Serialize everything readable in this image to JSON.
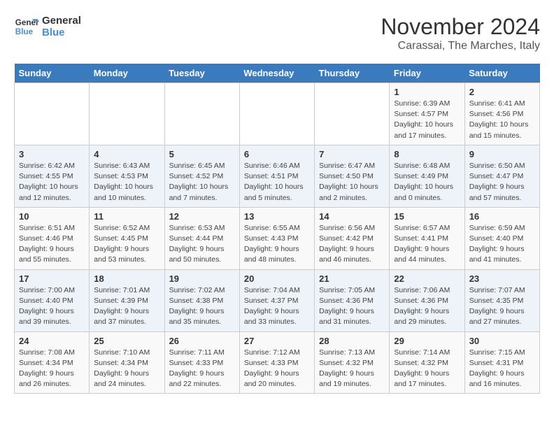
{
  "logo": {
    "line1": "General",
    "line2": "Blue"
  },
  "title": "November 2024",
  "location": "Carassai, The Marches, Italy",
  "days_of_week": [
    "Sunday",
    "Monday",
    "Tuesday",
    "Wednesday",
    "Thursday",
    "Friday",
    "Saturday"
  ],
  "weeks": [
    [
      {
        "day": "",
        "info": ""
      },
      {
        "day": "",
        "info": ""
      },
      {
        "day": "",
        "info": ""
      },
      {
        "day": "",
        "info": ""
      },
      {
        "day": "",
        "info": ""
      },
      {
        "day": "1",
        "info": "Sunrise: 6:39 AM\nSunset: 4:57 PM\nDaylight: 10 hours and 17 minutes."
      },
      {
        "day": "2",
        "info": "Sunrise: 6:41 AM\nSunset: 4:56 PM\nDaylight: 10 hours and 15 minutes."
      }
    ],
    [
      {
        "day": "3",
        "info": "Sunrise: 6:42 AM\nSunset: 4:55 PM\nDaylight: 10 hours and 12 minutes."
      },
      {
        "day": "4",
        "info": "Sunrise: 6:43 AM\nSunset: 4:53 PM\nDaylight: 10 hours and 10 minutes."
      },
      {
        "day": "5",
        "info": "Sunrise: 6:45 AM\nSunset: 4:52 PM\nDaylight: 10 hours and 7 minutes."
      },
      {
        "day": "6",
        "info": "Sunrise: 6:46 AM\nSunset: 4:51 PM\nDaylight: 10 hours and 5 minutes."
      },
      {
        "day": "7",
        "info": "Sunrise: 6:47 AM\nSunset: 4:50 PM\nDaylight: 10 hours and 2 minutes."
      },
      {
        "day": "8",
        "info": "Sunrise: 6:48 AM\nSunset: 4:49 PM\nDaylight: 10 hours and 0 minutes."
      },
      {
        "day": "9",
        "info": "Sunrise: 6:50 AM\nSunset: 4:47 PM\nDaylight: 9 hours and 57 minutes."
      }
    ],
    [
      {
        "day": "10",
        "info": "Sunrise: 6:51 AM\nSunset: 4:46 PM\nDaylight: 9 hours and 55 minutes."
      },
      {
        "day": "11",
        "info": "Sunrise: 6:52 AM\nSunset: 4:45 PM\nDaylight: 9 hours and 53 minutes."
      },
      {
        "day": "12",
        "info": "Sunrise: 6:53 AM\nSunset: 4:44 PM\nDaylight: 9 hours and 50 minutes."
      },
      {
        "day": "13",
        "info": "Sunrise: 6:55 AM\nSunset: 4:43 PM\nDaylight: 9 hours and 48 minutes."
      },
      {
        "day": "14",
        "info": "Sunrise: 6:56 AM\nSunset: 4:42 PM\nDaylight: 9 hours and 46 minutes."
      },
      {
        "day": "15",
        "info": "Sunrise: 6:57 AM\nSunset: 4:41 PM\nDaylight: 9 hours and 44 minutes."
      },
      {
        "day": "16",
        "info": "Sunrise: 6:59 AM\nSunset: 4:40 PM\nDaylight: 9 hours and 41 minutes."
      }
    ],
    [
      {
        "day": "17",
        "info": "Sunrise: 7:00 AM\nSunset: 4:40 PM\nDaylight: 9 hours and 39 minutes."
      },
      {
        "day": "18",
        "info": "Sunrise: 7:01 AM\nSunset: 4:39 PM\nDaylight: 9 hours and 37 minutes."
      },
      {
        "day": "19",
        "info": "Sunrise: 7:02 AM\nSunset: 4:38 PM\nDaylight: 9 hours and 35 minutes."
      },
      {
        "day": "20",
        "info": "Sunrise: 7:04 AM\nSunset: 4:37 PM\nDaylight: 9 hours and 33 minutes."
      },
      {
        "day": "21",
        "info": "Sunrise: 7:05 AM\nSunset: 4:36 PM\nDaylight: 9 hours and 31 minutes."
      },
      {
        "day": "22",
        "info": "Sunrise: 7:06 AM\nSunset: 4:36 PM\nDaylight: 9 hours and 29 minutes."
      },
      {
        "day": "23",
        "info": "Sunrise: 7:07 AM\nSunset: 4:35 PM\nDaylight: 9 hours and 27 minutes."
      }
    ],
    [
      {
        "day": "24",
        "info": "Sunrise: 7:08 AM\nSunset: 4:34 PM\nDaylight: 9 hours and 26 minutes."
      },
      {
        "day": "25",
        "info": "Sunrise: 7:10 AM\nSunset: 4:34 PM\nDaylight: 9 hours and 24 minutes."
      },
      {
        "day": "26",
        "info": "Sunrise: 7:11 AM\nSunset: 4:33 PM\nDaylight: 9 hours and 22 minutes."
      },
      {
        "day": "27",
        "info": "Sunrise: 7:12 AM\nSunset: 4:33 PM\nDaylight: 9 hours and 20 minutes."
      },
      {
        "day": "28",
        "info": "Sunrise: 7:13 AM\nSunset: 4:32 PM\nDaylight: 9 hours and 19 minutes."
      },
      {
        "day": "29",
        "info": "Sunrise: 7:14 AM\nSunset: 4:32 PM\nDaylight: 9 hours and 17 minutes."
      },
      {
        "day": "30",
        "info": "Sunrise: 7:15 AM\nSunset: 4:31 PM\nDaylight: 9 hours and 16 minutes."
      }
    ]
  ]
}
